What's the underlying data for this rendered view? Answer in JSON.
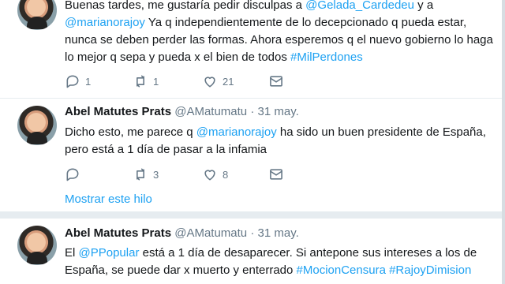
{
  "tweets": [
    {
      "text_parts": [
        "Buenas tardes, me gustaría pedir disculpas a ",
        "@Gelada_Cardedeu",
        " y a ",
        "@marianorajoy",
        " Ya q independientemente de lo decepcionado q pueda estar, nunca se deben perder las formas. Ahora esperemos q el nuevo gobierno lo haga lo mejor q sepa y pueda x el bien de todos ",
        "#MilPerdones"
      ],
      "actions": {
        "reply_count": "1",
        "retweet_count": "1",
        "like_count": "21"
      }
    },
    {
      "author_name": "Abel Matutes Prats",
      "handle": "@AMatumatu",
      "separator": "·",
      "date": "31 may.",
      "text_parts": [
        "Dicho esto, me parece q ",
        "@marianorajoy",
        " ha sido un buen presidente de España, pero está a 1 día de pasar a la infamia"
      ],
      "actions": {
        "reply_count": "",
        "retweet_count": "3",
        "like_count": "8"
      },
      "thread_link": "Mostrar este hilo"
    },
    {
      "author_name": "Abel Matutes Prats",
      "handle": "@AMatumatu",
      "separator": "·",
      "date": "31 may.",
      "text_parts": [
        "El ",
        "@PPopular",
        " está a 1 día de desaparecer. Si antepone sus intereses a los de España, se puede dar x muerto y enterrado ",
        "#MocionCensura",
        " ",
        "#RajoyDimision"
      ]
    }
  ],
  "icons": [
    "reply-icon",
    "retweet-icon",
    "like-icon",
    "message-icon"
  ],
  "colors": {
    "link": "#1da1f2",
    "muted": "#657786",
    "text": "#14171a",
    "divider": "#e6ecf0"
  }
}
